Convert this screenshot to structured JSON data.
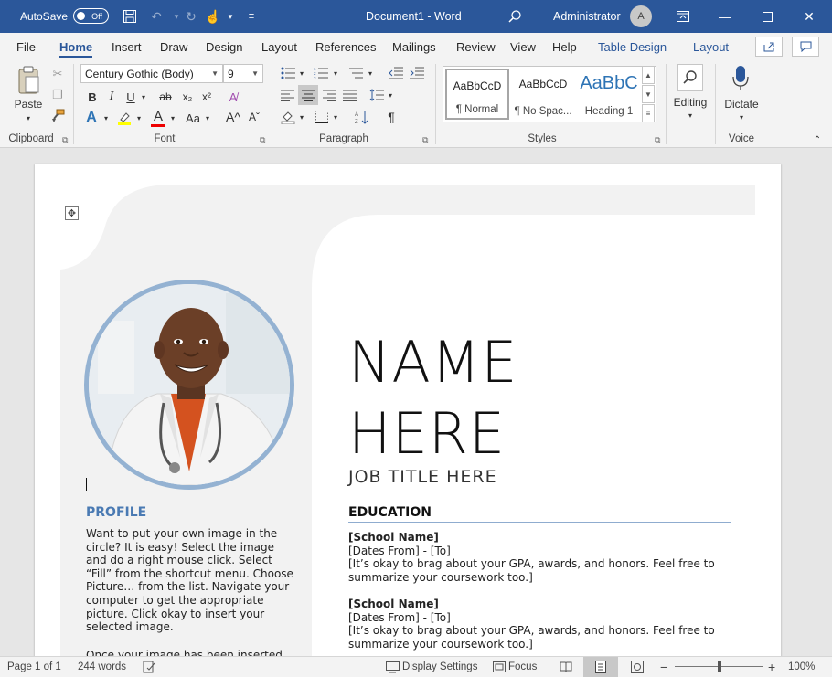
{
  "titlebar": {
    "autosave_label": "AutoSave",
    "autosave_state": "Off",
    "doc_title": "Document1  -  Word",
    "user_name": "Administrator",
    "user_initial": "A"
  },
  "tabs": {
    "file": "File",
    "home": "Home",
    "insert": "Insert",
    "draw": "Draw",
    "design": "Design",
    "layout": "Layout",
    "references": "References",
    "mailings": "Mailings",
    "review": "Review",
    "view": "View",
    "help": "Help",
    "table_design": "Table Design",
    "table_layout": "Layout"
  },
  "ribbon": {
    "paste_label": "Paste",
    "clipboard_label": "Clipboard",
    "font_name": "Century Gothic (Body)",
    "font_size": "9",
    "font_label": "Font",
    "paragraph_label": "Paragraph",
    "styles_label": "Styles",
    "styles": [
      {
        "sample": "AaBbCcD",
        "name": "¶ Normal"
      },
      {
        "sample": "AaBbCcD",
        "name": "¶ No Spac..."
      },
      {
        "sample": "AaBbC",
        "name": "Heading 1"
      }
    ],
    "editing_label": "Editing",
    "dictate_label": "Dictate",
    "voice_label": "Voice",
    "accent_color": "#2b579a"
  },
  "document": {
    "name_line1": "NAME",
    "name_line2": "HERE",
    "job_title": "JOB TITLE HERE",
    "profile_heading": "PROFILE",
    "profile_text": "Want to put your own image in the circle?  It is easy!  Select the image and do a right mouse click.  Select “Fill” from the shortcut menu.  Choose Picture… from the list.  Navigate your computer to get the appropriate picture.  Click okay to insert your selected image.",
    "profile_text2": "Once your image has been inserted",
    "education_heading": "EDUCATION",
    "education": [
      {
        "school": "[School Name]",
        "dates": "[Dates From] - [To]",
        "desc": "[It’s okay to brag about your GPA, awards, and honors. Feel free to summarize your coursework too.]"
      },
      {
        "school": "[School Name]",
        "dates": "[Dates From] - [To]",
        "desc": "[It’s okay to brag about your GPA, awards, and honors. Feel free to summarize your coursework too.]"
      }
    ]
  },
  "statusbar": {
    "page": "Page 1 of 1",
    "words": "244 words",
    "display_settings": "Display Settings",
    "focus": "Focus",
    "zoom": "100%"
  }
}
